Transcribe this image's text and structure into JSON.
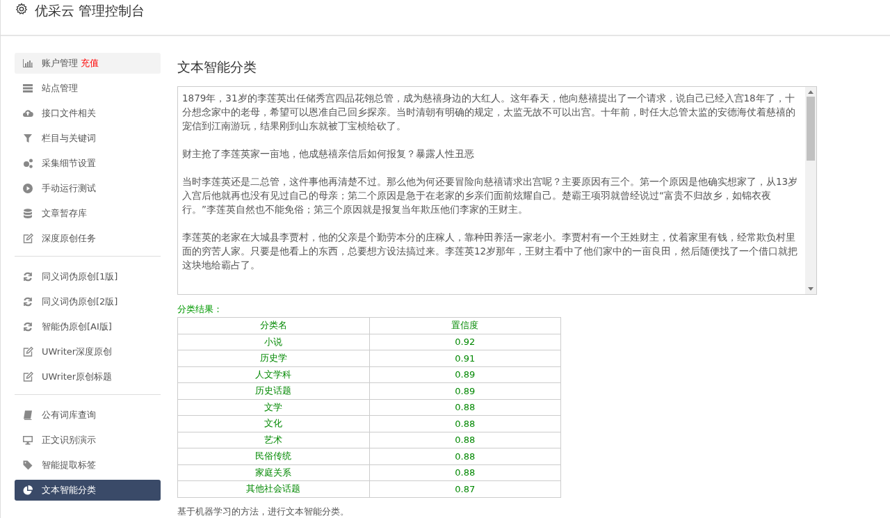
{
  "header": {
    "title": "优采云 管理控制台"
  },
  "sidebar": {
    "groups": [
      [
        {
          "label": "账户管理",
          "badge": "充值",
          "selected": false
        },
        {
          "label": "站点管理",
          "selected": false
        },
        {
          "label": "接口文件相关",
          "selected": false
        },
        {
          "label": "栏目与关键词",
          "selected": false
        },
        {
          "label": "采集细节设置",
          "selected": false
        },
        {
          "label": "手动运行测试",
          "selected": false
        },
        {
          "label": "文章暂存库",
          "selected": false
        },
        {
          "label": "深度原创任务",
          "selected": false
        }
      ],
      [
        {
          "label": "同义词伪原创[1版]",
          "selected": false
        },
        {
          "label": "同义词伪原创[2版]",
          "selected": false
        },
        {
          "label": "智能伪原创[AI版]",
          "selected": false
        },
        {
          "label": "UWriter深度原创",
          "selected": false
        },
        {
          "label": "UWriter原创标题",
          "selected": false
        }
      ],
      [
        {
          "label": "公有词库查询",
          "selected": false
        },
        {
          "label": "正文识别演示",
          "selected": false
        },
        {
          "label": "智能提取标签",
          "selected": false
        },
        {
          "label": "文本智能分类",
          "selected": true
        }
      ]
    ]
  },
  "main": {
    "title": "文本智能分类",
    "input_paragraphs": [
      "1879年，31岁的李莲英出任储秀宫四品花翎总管，成为慈禧身边的大红人。这年春天，他向慈禧提出了一个请求，说自己已经入宫18年了，十分想念家中的老母，希望可以恩准自己回乡探亲。当时清朝有明确的规定，太监无故不可以出宫。十年前，时任大总管太监的安德海仗着慈禧的宠信到江南游玩，结果刚到山东就被丁宝桢给砍了。",
      "财主抢了李莲英家一亩地，他成慈禧亲信后如何报复？暴露人性丑恶",
      "当时李莲英还是二总管，这件事他再清楚不过。那么他为何还要冒险向慈禧请求出宫呢？主要原因有三个。第一个原因是他确实想家了，从13岁入宫后他就再也没有见过自己的母亲；第二个原因是急于在老家的乡亲们面前炫耀自己。楚霸王项羽就曾经说过“富贵不归故乡，如锦衣夜行。”李莲英自然也不能免俗；第三个原因就是报复当年欺压他们李家的王财主。",
      "李莲英的老家在大城县李贾村，他的父亲是个勤劳本分的庄稼人，靠种田养活一家老小。李贾村有一个王姓财主，仗着家里有钱，经常欺负村里面的穷苦人家。只要是他看上的东西，总要想方设法搞过来。李莲英12岁那年，王财主看中了他们家中的一亩良田，然后随便找了一个借口就把这块地给霸占了。"
    ],
    "result_label": "分类结果：",
    "table": {
      "columns": [
        "分类名",
        "置信度"
      ],
      "rows": [
        [
          "小说",
          "0.92"
        ],
        [
          "历史学",
          "0.91"
        ],
        [
          "人文学科",
          "0.89"
        ],
        [
          "历史话题",
          "0.89"
        ],
        [
          "文学",
          "0.88"
        ],
        [
          "文化",
          "0.88"
        ],
        [
          "艺术",
          "0.88"
        ],
        [
          "民俗传统",
          "0.88"
        ],
        [
          "家庭关系",
          "0.88"
        ],
        [
          "其他社会话题",
          "0.87"
        ]
      ]
    },
    "footnote": "基于机器学习的方法，进行文本智能分类。"
  }
}
